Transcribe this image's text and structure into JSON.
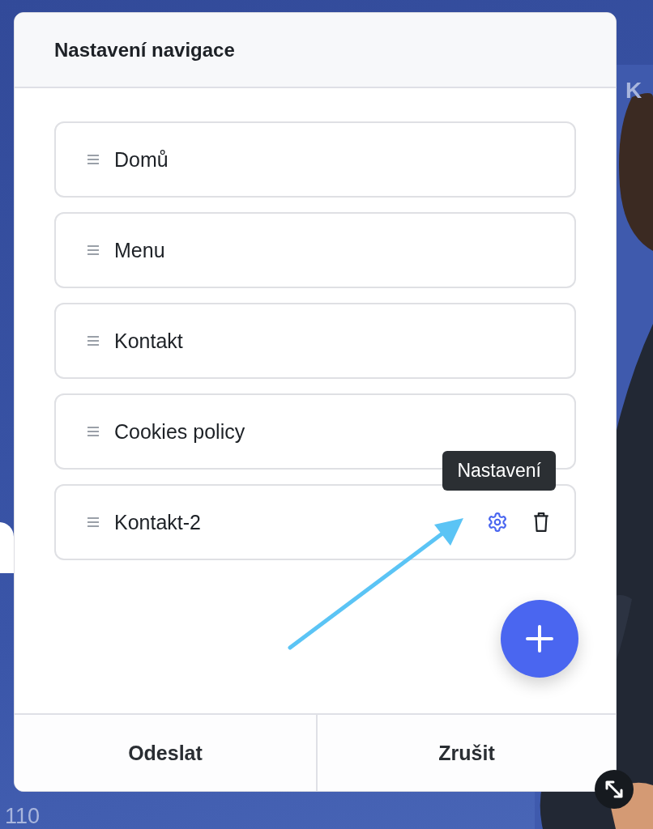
{
  "background": {
    "texts": [
      "K",
      "110"
    ]
  },
  "dialog": {
    "title": "Nastavení navigace",
    "items": [
      {
        "label": "Domů",
        "show_actions": false
      },
      {
        "label": "Menu",
        "show_actions": false
      },
      {
        "label": "Kontakt",
        "show_actions": false
      },
      {
        "label": "Cookies policy",
        "show_actions": false
      },
      {
        "label": "Kontakt-2",
        "show_actions": true
      }
    ],
    "tooltip": "Nastavení",
    "buttons": [
      "Odeslat",
      "Zrušit"
    ]
  }
}
